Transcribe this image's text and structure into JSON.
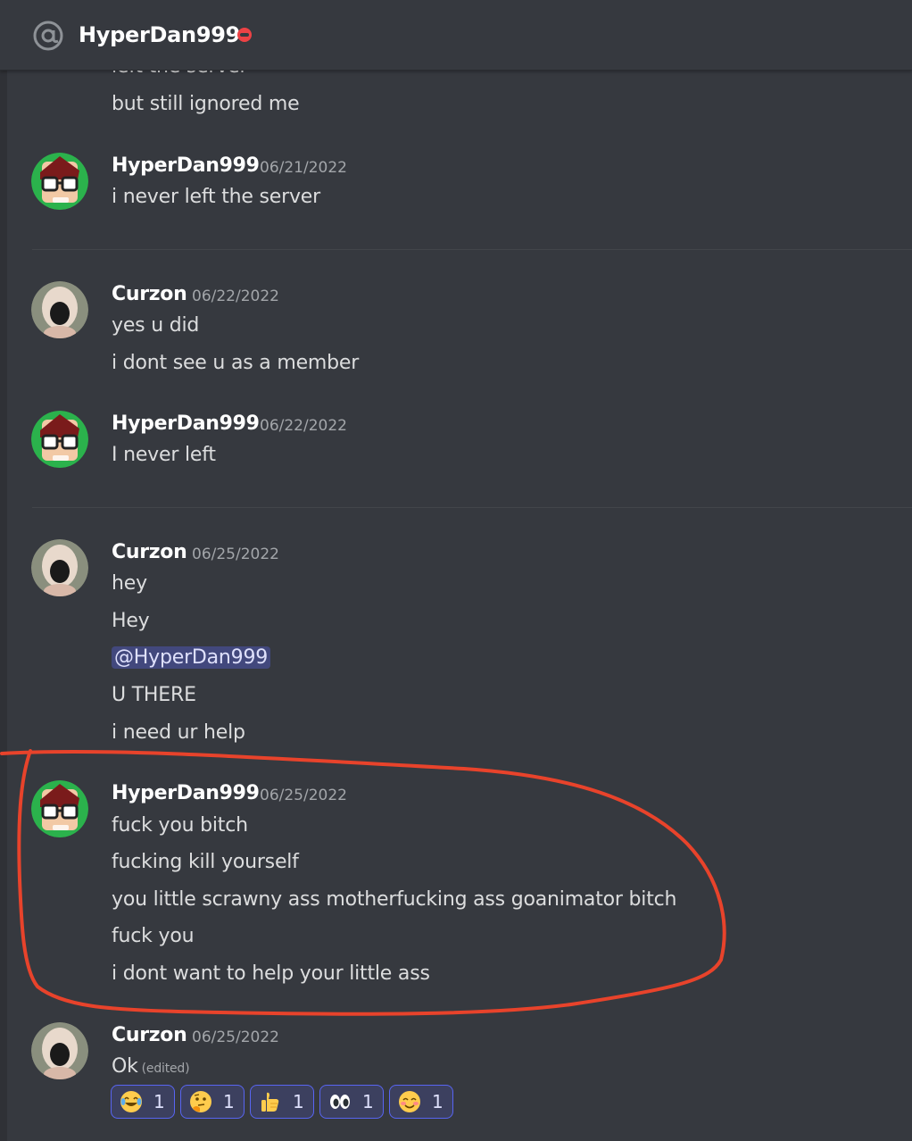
{
  "header": {
    "title": "HyperDan999",
    "status_color": "#ed4245"
  },
  "colors": {
    "background": "#36393f",
    "text": "#dcddde",
    "timestamp": "#a3a6aa",
    "mention_bg": "#4a4f83",
    "reaction_border": "#5865f2",
    "annotation": "#e8432b"
  },
  "messages": [
    {
      "lines": [
        "left the server",
        "but still ignored me"
      ]
    },
    {
      "author": "HyperDan999",
      "timestamp": "06/21/2022",
      "avatar": "hyperdan-avatar",
      "lines": [
        "i never left the server"
      ]
    },
    {
      "author": "Curzon",
      "timestamp": "06/22/2022",
      "avatar": "curzon-avatar",
      "lines": [
        "yes u did",
        "i dont see u as a member"
      ]
    },
    {
      "author": "HyperDan999",
      "timestamp": "06/22/2022",
      "avatar": "hyperdan-avatar",
      "lines": [
        "I never left"
      ]
    },
    {
      "author": "Curzon",
      "timestamp": "06/25/2022",
      "avatar": "curzon-avatar",
      "lines": [
        "hey",
        "Hey",
        "@HyperDan999",
        "U THERE",
        "i need ur help"
      ]
    },
    {
      "author": "HyperDan999",
      "timestamp": "06/25/2022",
      "avatar": "hyperdan-avatar",
      "lines": [
        "fuck you bitch",
        "fucking kill yourself",
        "you little scrawny ass motherfucking ass goanimator bitch",
        "fuck you",
        "i dont want to help your little ass"
      ]
    },
    {
      "author": "Curzon",
      "timestamp": "06/25/2022",
      "avatar": "curzon-avatar",
      "lines": [
        "Ok"
      ],
      "edited_label": "(edited)"
    }
  ],
  "reactions": [
    {
      "emoji": "joy-emoji",
      "count": "1"
    },
    {
      "emoji": "thinking-emoji",
      "count": "1"
    },
    {
      "emoji": "thumbs-up-emoji",
      "count": "1"
    },
    {
      "emoji": "eyes-emoji",
      "count": "1"
    },
    {
      "emoji": "blush-emoji",
      "count": "1"
    }
  ]
}
